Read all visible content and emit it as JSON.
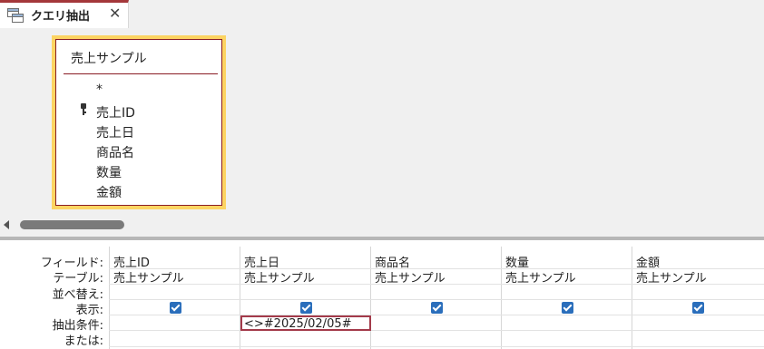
{
  "tab": {
    "title": "クエリ抽出",
    "close": "✕"
  },
  "table_box": {
    "title": "売上サンプル",
    "fields": [
      "*",
      "売上ID",
      "売上日",
      "商品名",
      "数量",
      "金額"
    ]
  },
  "grid": {
    "row_labels": [
      "フィールド:",
      "テーブル:",
      "並べ替え:",
      "表示:",
      "抽出条件:",
      "または:"
    ],
    "columns": [
      {
        "field": "売上ID",
        "table": "売上サンプル",
        "show": true,
        "criteria": ""
      },
      {
        "field": "売上日",
        "table": "売上サンプル",
        "show": true,
        "criteria": "<>#2025/02/05#"
      },
      {
        "field": "商品名",
        "table": "売上サンプル",
        "show": true,
        "criteria": ""
      },
      {
        "field": "数量",
        "table": "売上サンプル",
        "show": true,
        "criteria": ""
      },
      {
        "field": "金額",
        "table": "売上サンプル",
        "show": true,
        "criteria": ""
      }
    ]
  },
  "colors": {
    "accent": "#a4373a",
    "table_highlight": "#fcd462",
    "checkbox": "#2a6ebb"
  }
}
